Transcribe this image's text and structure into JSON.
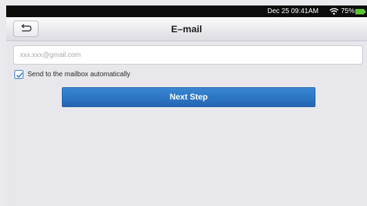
{
  "status_bar": {
    "datetime": "Dec 25 09:41AM",
    "battery_percent": "75%",
    "battery_level": 0.75,
    "icons": [
      "wifi-icon",
      "battery-icon"
    ]
  },
  "header": {
    "title": "E–mail",
    "back_icon": "back-arrow-icon"
  },
  "form": {
    "email_placeholder": "xxx.xxx@gmail.com",
    "email_value": "",
    "auto_send_label": "Send to the mailbox automatically",
    "auto_send_checked": true,
    "next_button_label": "Next Step"
  },
  "colors": {
    "accent": "#2e77c4",
    "button": "#2a6fbe",
    "battery": "#5bc236",
    "background": "#e7e7ec"
  }
}
